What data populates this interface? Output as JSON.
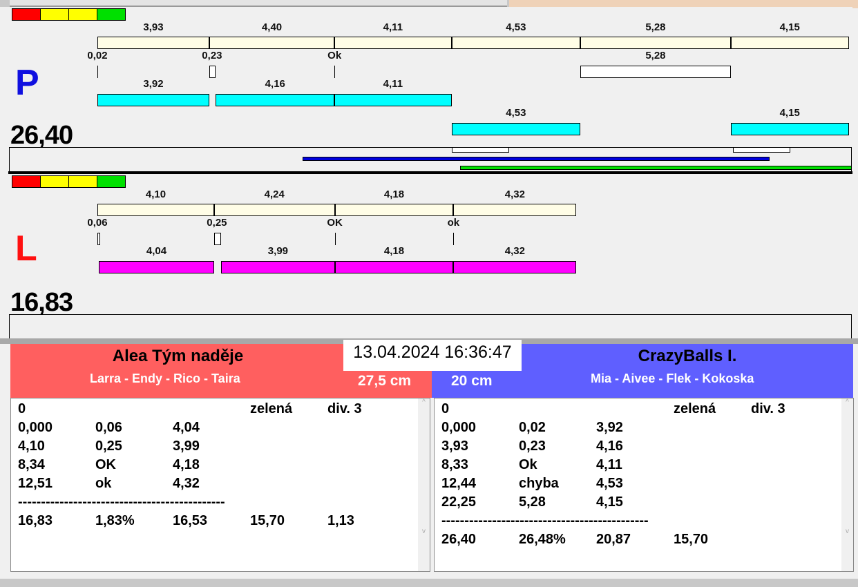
{
  "colors": {
    "red": "#ff0000",
    "yellow": "#ffff00",
    "green": "#00e000",
    "ruler": "#fffde6",
    "cyan": "#00ffff",
    "magenta": "#ff00ff",
    "blue": "#0000dd",
    "team_left": "#ff5f5f",
    "team_right": "#5f5fff"
  },
  "chart_data": {
    "type": "table",
    "P": {
      "letter": "P",
      "total": "26,40",
      "ruler": [
        {
          "from": 0,
          "to": 3.93,
          "label": "3,93"
        },
        {
          "from": 3.93,
          "to": 8.33,
          "label": "4,40"
        },
        {
          "from": 8.33,
          "to": 12.44,
          "label": "4,11"
        },
        {
          "from": 12.44,
          "to": 16.97,
          "label": "4,53"
        },
        {
          "from": 16.97,
          "to": 22.25,
          "label": "5,28"
        },
        {
          "from": 22.25,
          "to": 26.4,
          "label": "4,15"
        }
      ],
      "markers": [
        {
          "at": 0,
          "label": "0,02",
          "kind": "line"
        },
        {
          "at": 3.93,
          "to": 4.16,
          "label": "0,23",
          "kind": "box"
        },
        {
          "at": 8.33,
          "label": "Ok",
          "kind": "line"
        },
        {
          "at": 16.97,
          "to": 22.25,
          "label": "5,28",
          "kind": "box"
        }
      ],
      "bars1": [
        {
          "from": 0,
          "to": 3.93,
          "label": "3,92"
        },
        {
          "from": 4.16,
          "to": 8.33,
          "label": "4,16"
        },
        {
          "from": 8.33,
          "to": 12.44,
          "label": "4,11"
        }
      ],
      "bars2": [
        {
          "from": 12.44,
          "to": 16.97,
          "label": "4,53"
        },
        {
          "from": 22.25,
          "to": 26.4,
          "label": "4,15"
        }
      ]
    },
    "L": {
      "letter": "L",
      "total": "16,83",
      "ruler": [
        {
          "from": 0,
          "to": 4.1,
          "label": "4,10"
        },
        {
          "from": 4.1,
          "to": 8.34,
          "label": "4,24"
        },
        {
          "from": 8.34,
          "to": 12.51,
          "label": "4,18"
        },
        {
          "from": 12.51,
          "to": 16.83,
          "label": "4,32"
        }
      ],
      "markers": [
        {
          "at": 0,
          "to": 0.06,
          "label": "0,06",
          "kind": "box"
        },
        {
          "at": 4.1,
          "to": 4.35,
          "label": "0,25",
          "kind": "box"
        },
        {
          "at": 8.34,
          "label": "OK",
          "kind": "line"
        },
        {
          "at": 12.51,
          "label": "ok",
          "kind": "line"
        }
      ],
      "bars1": [
        {
          "from": 0.05,
          "to": 4.1,
          "label": "4,04"
        },
        {
          "from": 4.35,
          "to": 8.34,
          "label": "3,99"
        },
        {
          "from": 8.34,
          "to": 12.51,
          "label": "4,18"
        },
        {
          "from": 12.51,
          "to": 16.83,
          "label": "4,32"
        }
      ],
      "bars2": []
    }
  },
  "datetime": "13.04.2024 16:36:47",
  "left_team": {
    "name": "Alea Tým naděje",
    "members": "Larra - Endy - Rico - Taira",
    "height": "27,5 cm",
    "rows": [
      [
        "0",
        "",
        "",
        "zelená",
        "div. 3"
      ],
      [
        "0,000",
        "0,06",
        "4,04"
      ],
      [
        "4,10",
        "0,25",
        "3,99"
      ],
      [
        "8,34",
        "OK",
        "4,18"
      ],
      [
        "12,51",
        "ok",
        "4,32"
      ],
      [
        "---------------------------------------------"
      ],
      [
        "16,83",
        "1,83%",
        "16,53",
        "15,70",
        "1,13"
      ]
    ]
  },
  "right_team": {
    "name": "CrazyBalls I.",
    "members": "Mia - Aivee - Flek - Kokoska",
    "height": "20 cm",
    "rows": [
      [
        "0",
        "",
        "",
        "zelená",
        "div. 3"
      ],
      [
        "0,000",
        "0,02",
        "3,92"
      ],
      [
        "3,93",
        "0,23",
        "4,16"
      ],
      [
        "8,33",
        "Ok",
        "4,11"
      ],
      [
        "12,44",
        "chyba",
        "4,53"
      ],
      [
        "22,25",
        "5,28",
        "4,15"
      ],
      [
        "---------------------------------------------"
      ],
      [
        "26,40",
        "26,48%",
        "20,87",
        "15,70"
      ]
    ]
  }
}
